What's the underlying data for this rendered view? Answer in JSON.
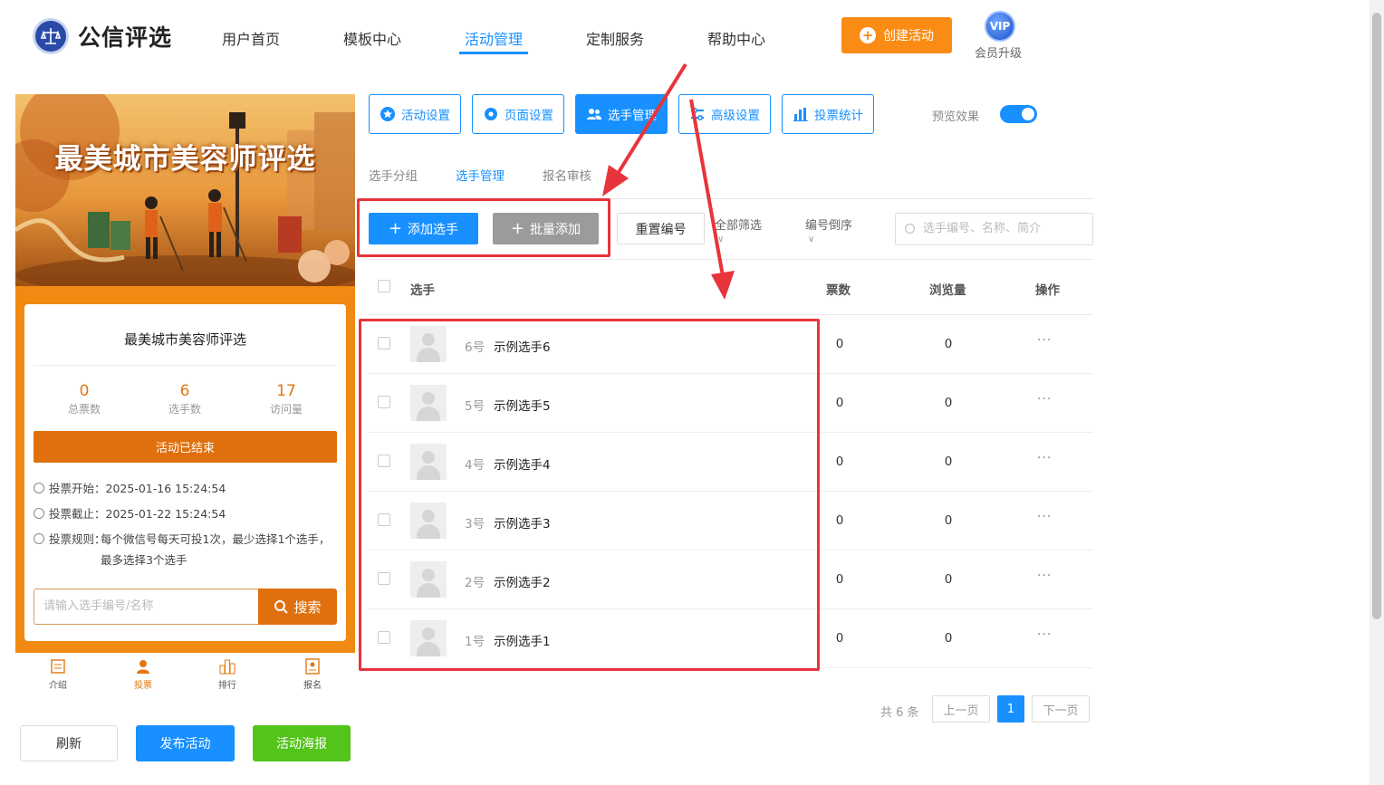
{
  "header": {
    "logo_text": "公信评选",
    "nav": [
      "用户首页",
      "模板中心",
      "活动管理",
      "定制服务",
      "帮助中心"
    ],
    "create_label": "创建活动",
    "vip_badge": "VIP",
    "vip_label": "会员升级"
  },
  "preview": {
    "banner_title": "最美城市美容师评选",
    "card_title": "最美城市美容师评选",
    "stats": [
      {
        "num": "0",
        "label": "总票数"
      },
      {
        "num": "6",
        "label": "选手数"
      },
      {
        "num": "17",
        "label": "访问量"
      }
    ],
    "ended_label": "活动已结束",
    "vote_start_label": "投票开始：",
    "vote_start": "2025-01-16 15:24:54",
    "vote_end_label": "投票截止：",
    "vote_end": "2025-01-22 15:24:54",
    "rules_label": "投票规则：",
    "rules_text": "每个微信号每天可投1次，最少选择1个选手，最多选择3个选手",
    "search_placeholder": "请输入选手编号/名称",
    "search_button": "搜索",
    "bottom_nav": [
      {
        "label": "介绍",
        "icon": "doc-icon"
      },
      {
        "label": "投票",
        "icon": "user-icon",
        "active": true
      },
      {
        "label": "排行",
        "icon": "rank-icon"
      },
      {
        "label": "报名",
        "icon": "signup-icon"
      }
    ]
  },
  "bottom_actions": {
    "refresh": "刷新",
    "publish": "发布活动",
    "poster": "活动海报"
  },
  "toolbar": {
    "tabs": [
      "活动设置",
      "页面设置",
      "选手管理",
      "高级设置",
      "投票统计"
    ],
    "preview_label": "预览效果",
    "preview_on": true
  },
  "subtabs": [
    "选手分组",
    "选手管理",
    "报名审核"
  ],
  "actions": {
    "add": "添加选手",
    "batch_add": "批量添加",
    "reset": "重置编号",
    "filter": "全部筛选",
    "sort": "编号倒序",
    "search_placeholder": "选手编号、名称、简介"
  },
  "table": {
    "headers": {
      "player": "选手",
      "votes": "票数",
      "views": "浏览量",
      "ops": "操作"
    },
    "rows": [
      {
        "num": "6号",
        "name": "示例选手6",
        "votes": "0",
        "views": "0"
      },
      {
        "num": "5号",
        "name": "示例选手5",
        "votes": "0",
        "views": "0"
      },
      {
        "num": "4号",
        "name": "示例选手4",
        "votes": "0",
        "views": "0"
      },
      {
        "num": "3号",
        "name": "示例选手3",
        "votes": "0",
        "views": "0"
      },
      {
        "num": "2号",
        "name": "示例选手2",
        "votes": "0",
        "views": "0"
      },
      {
        "num": "1号",
        "name": "示例选手1",
        "votes": "0",
        "views": "0"
      }
    ],
    "more": "···"
  },
  "pagination": {
    "total": "共 6 条",
    "prev": "上一页",
    "current": "1",
    "next": "下一页"
  },
  "colors": {
    "primary": "#1890ff",
    "orange": "#fa8c16",
    "annotation_red": "#e8343b",
    "green": "#52c41a"
  }
}
